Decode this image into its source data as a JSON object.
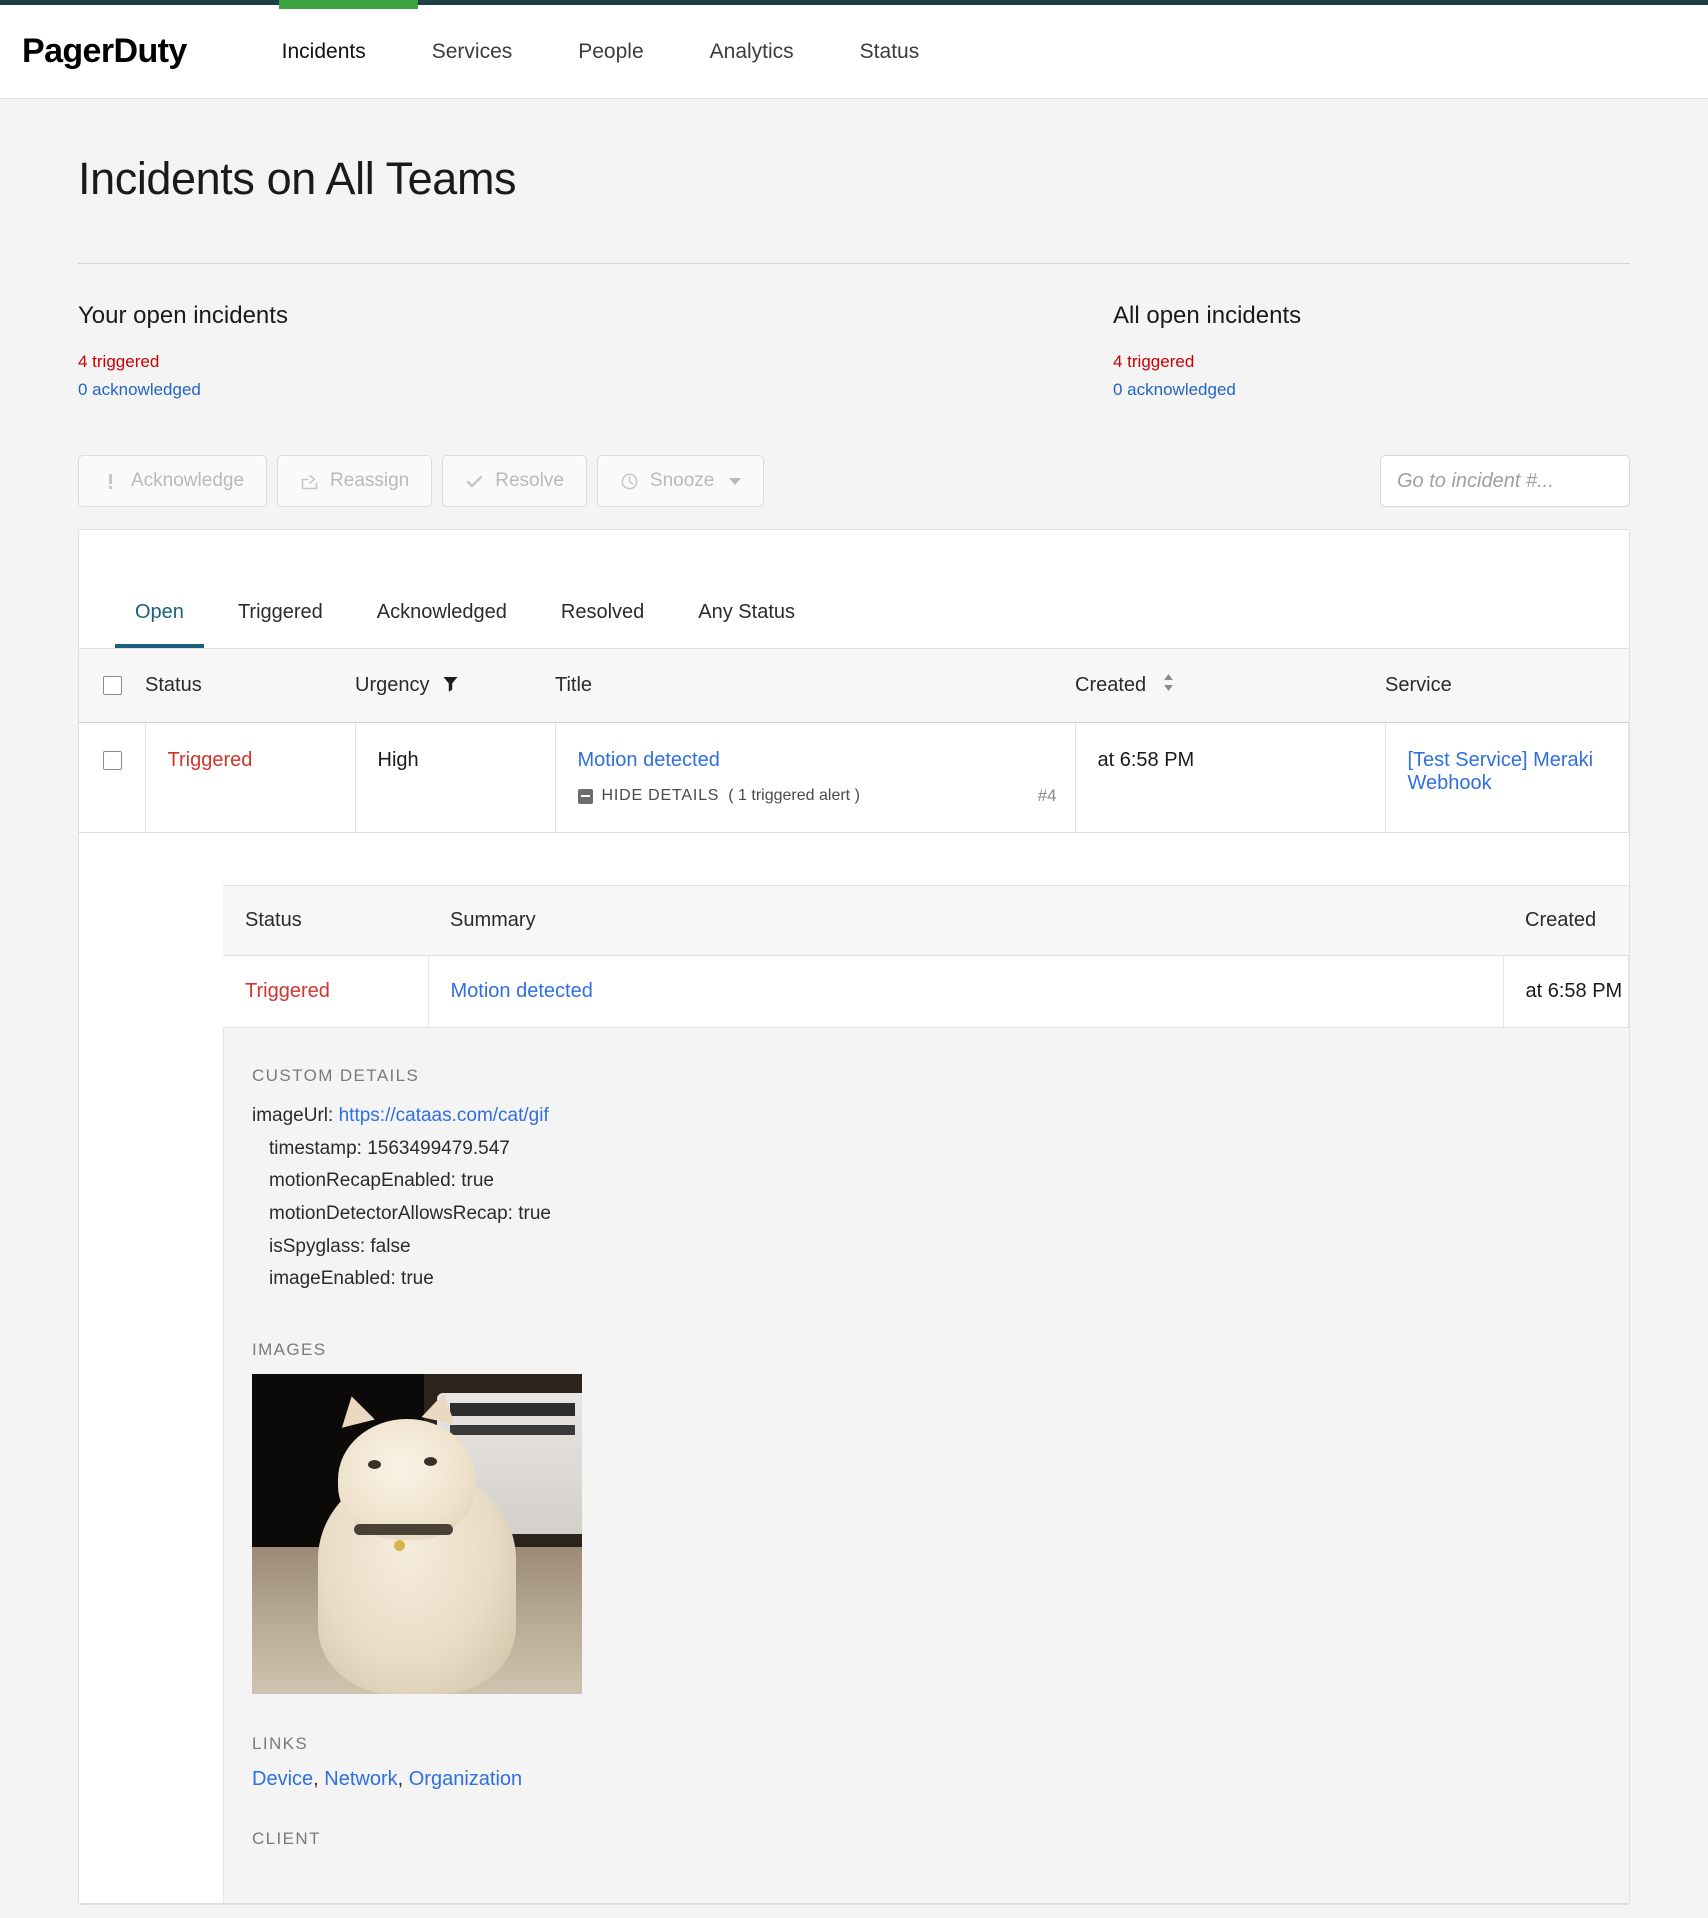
{
  "nav": {
    "brand": "PagerDuty",
    "accent_dark": "#1c3e45",
    "accent_green": "#3aa33f",
    "links": [
      {
        "label": "Incidents",
        "active": true
      },
      {
        "label": "Services",
        "active": false
      },
      {
        "label": "People",
        "active": false
      },
      {
        "label": "Analytics",
        "active": false
      },
      {
        "label": "Status",
        "active": false
      }
    ]
  },
  "page": {
    "title": "Incidents on All Teams"
  },
  "stats": {
    "mine": {
      "heading": "Your open incidents",
      "triggered": "4 triggered",
      "acknowledged": "0 acknowledged"
    },
    "all": {
      "heading": "All open incidents",
      "triggered": "4 triggered",
      "acknowledged": "0 acknowledged"
    },
    "triggered_color": "#cc0000",
    "ack_color": "#2464c4"
  },
  "actions": {
    "acknowledge": "Acknowledge",
    "reassign": "Reassign",
    "resolve": "Resolve",
    "snooze": "Snooze",
    "goto_placeholder": "Go to incident #...",
    "goto_value": ""
  },
  "tabs": [
    {
      "label": "Open",
      "active": true
    },
    {
      "label": "Triggered",
      "active": false
    },
    {
      "label": "Acknowledged",
      "active": false
    },
    {
      "label": "Resolved",
      "active": false
    },
    {
      "label": "Any Status",
      "active": false
    }
  ],
  "table": {
    "headers": {
      "status": "Status",
      "urgency": "Urgency",
      "title": "Title",
      "created": "Created",
      "service": "Service"
    },
    "rows": [
      {
        "status": "Triggered",
        "urgency": "High",
        "title": "Motion detected",
        "toggle_label": "HIDE DETAILS",
        "alert_count": "( 1 triggered alert )",
        "incident_number": "#4",
        "created": "at 6:58 PM",
        "service": "[Test Service] Meraki Webhook"
      }
    ]
  },
  "detail": {
    "alerts_headers": {
      "status": "Status",
      "summary": "Summary",
      "created": "Created"
    },
    "alerts_rows": [
      {
        "status": "Triggered",
        "summary": "Motion detected",
        "created": "at 6:58 PM"
      }
    ],
    "custom_details_label": "CUSTOM DETAILS",
    "custom_details": [
      {
        "key": "imageUrl:",
        "value": "https://cataas.com/cat/gif",
        "is_link": true,
        "indent": false
      },
      {
        "key": "timestamp:",
        "value": "1563499479.547",
        "is_link": false,
        "indent": true
      },
      {
        "key": "motionRecapEnabled:",
        "value": "true",
        "is_link": false,
        "indent": true
      },
      {
        "key": "motionDetectorAllowsRecap:",
        "value": "true",
        "is_link": false,
        "indent": true
      },
      {
        "key": "isSpyglass:",
        "value": "false",
        "is_link": false,
        "indent": true
      },
      {
        "key": "imageEnabled:",
        "value": "true",
        "is_link": false,
        "indent": true
      }
    ],
    "images_label": "IMAGES",
    "image_alt": "cat-gif-preview",
    "links_label": "LINKS",
    "links": [
      "Device",
      "Network",
      "Organization"
    ],
    "links_separator": ",",
    "client_label": "CLIENT"
  }
}
